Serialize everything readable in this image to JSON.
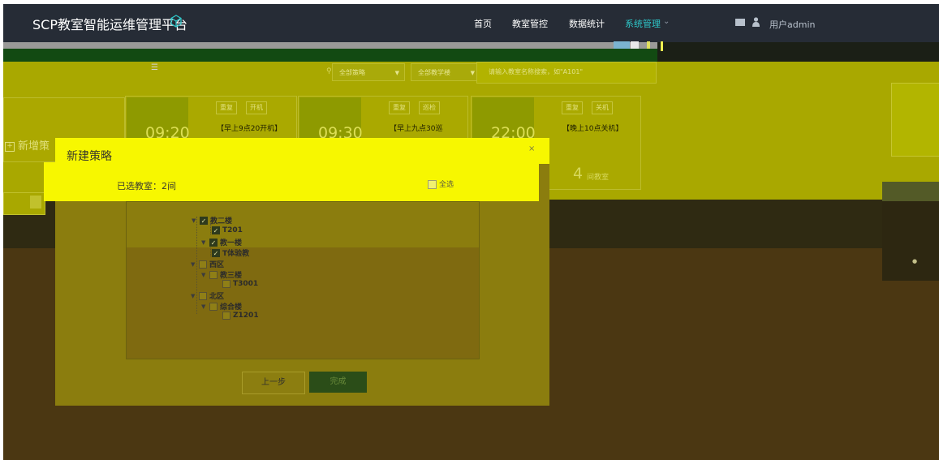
{
  "nav": {
    "title": "SCP教室智能运维管理平台",
    "menu": [
      "首页",
      "教室管控",
      "数据统计",
      "系统管理"
    ],
    "active_menu": "系统管理",
    "user": "用户admin",
    "accent_color": "#2ec7c9",
    "bg_color": "#262c36"
  },
  "filters": {
    "strategy": "全部策略",
    "building": "全部教学楼",
    "search_placeholder": "请输入教室名称搜索，如\"A101\""
  },
  "cards": [
    {
      "time": "09:20",
      "tags": [
        "重复",
        "开机"
      ],
      "desc": "【早上9点20开机】",
      "stat": ""
    },
    {
      "time": "09:30",
      "tags": [
        "重复",
        "巡检"
      ],
      "desc": "【早上九点30巡",
      "stat": ""
    },
    {
      "time": "22:00",
      "tags": [
        "重复",
        "关机"
      ],
      "desc": "【晚上10点关机】",
      "stat": "4",
      "stat_label": "间教室"
    }
  ],
  "add_button": "新增策",
  "modal": {
    "title": "新建策略",
    "selected": "已选教室：2间",
    "select_all": "全选",
    "prev": "上一步",
    "done": "完成",
    "tree": [
      {
        "label": "教二楼",
        "checked": true,
        "level": 1
      },
      {
        "label": "T201",
        "checked": true,
        "level": 2
      },
      {
        "label": "教一楼",
        "checked": true,
        "level": 1
      },
      {
        "label": "T体验教",
        "checked": true,
        "level": 2
      },
      {
        "label": "西区",
        "checked": false,
        "level": 0
      },
      {
        "label": "教三楼",
        "checked": false,
        "level": 1
      },
      {
        "label": "T3001",
        "checked": false,
        "level": 2
      },
      {
        "label": "北区",
        "checked": false,
        "level": 0
      },
      {
        "label": "综合楼",
        "checked": false,
        "level": 1
      },
      {
        "label": "Z1201",
        "checked": false,
        "level": 2
      }
    ]
  }
}
